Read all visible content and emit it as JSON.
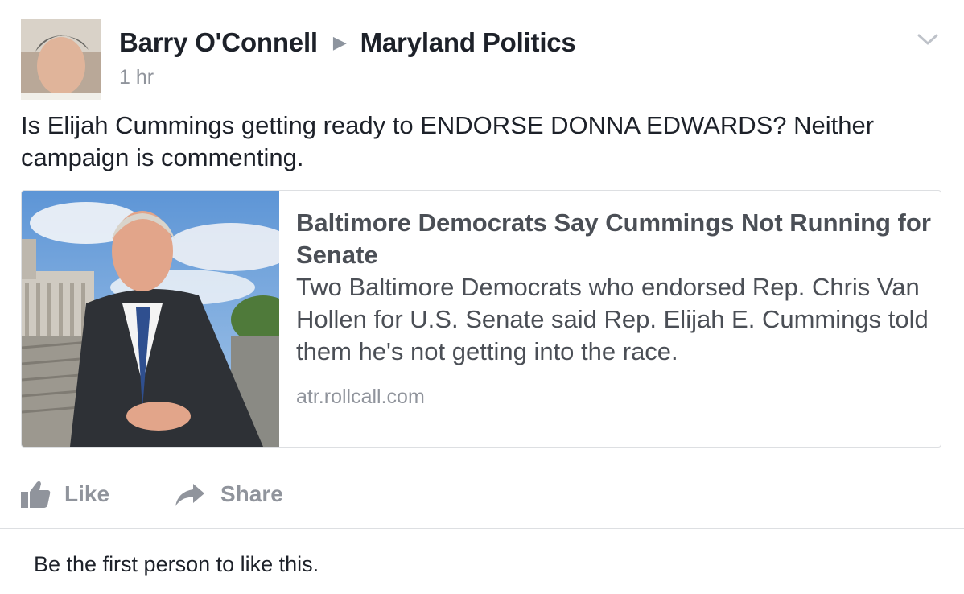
{
  "post": {
    "author": "Barry O'Connell",
    "separator_icon": "triangle-right-icon",
    "group": "Maryland Politics",
    "time": "1 hr",
    "text": "Is Elijah Cummings getting ready to ENDORSE DONNA EDWARDS? Neither campaign is commenting."
  },
  "link": {
    "title": "Baltimore Democrats Say Cummings Not Running for Senate",
    "description": "Two Baltimore Democrats who endorsed Rep. Chris Van Hollen for U.S. Senate said Rep. Elijah E. Cummings told them he's not getting into the race.",
    "domain": "atr.rollcall.com"
  },
  "actions": {
    "like_label": "Like",
    "like_icon": "thumbs-up-icon",
    "share_label": "Share",
    "share_icon": "share-arrow-icon"
  },
  "likes_summary": "Be the first person to like this.",
  "colors": {
    "text_primary": "#1d2129",
    "text_secondary": "#90949c",
    "link_text": "#4b4f56",
    "border": "#dddfe2"
  }
}
